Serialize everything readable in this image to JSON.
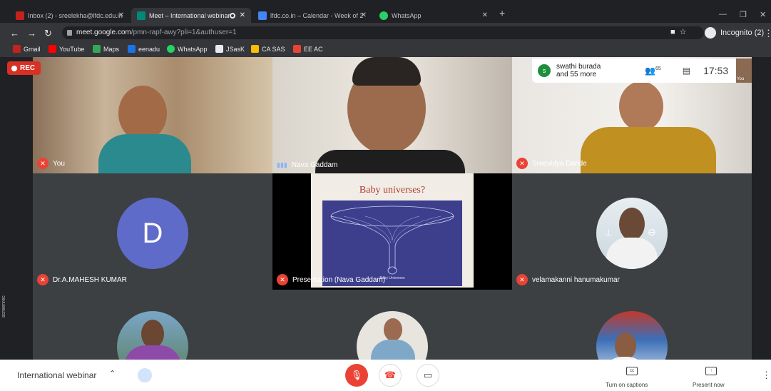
{
  "browser": {
    "tabs": [
      {
        "title": "Inbox (2) - sreelekha@lfdc.edu.in",
        "color": "#c5221f"
      },
      {
        "title": "Meet – International webinar",
        "color": "#00897b"
      },
      {
        "title": "lfdc.co.in – Calendar - Week of 2",
        "color": "#4285f4"
      },
      {
        "title": "WhatsApp",
        "color": "#25d366"
      }
    ],
    "new_tab": "+",
    "url_host": "meet.google.com",
    "url_path": "/pmn-rapf-awy?pli=1&authuser=1",
    "incognito": "Incognito (2)",
    "bookmarks": [
      {
        "label": "Gmail",
        "color": "#c5221f"
      },
      {
        "label": "YouTube",
        "color": "#ff0000"
      },
      {
        "label": "Maps",
        "color": "#34a853"
      },
      {
        "label": "eenadu",
        "color": "#1a73e8"
      },
      {
        "label": "WhatsApp",
        "color": "#25d366"
      },
      {
        "label": "JSasK",
        "color": "#e8eaed"
      },
      {
        "label": "CA SAS",
        "color": "#fbbc04"
      },
      {
        "label": "EE AC",
        "color": "#ea4335"
      }
    ]
  },
  "meet": {
    "rec_label": "REC",
    "participants_summary": "swathi burada\nand 55 more",
    "summary_avatar": "s",
    "people_count": "65",
    "clock": "17:53",
    "self_label": "You",
    "screen_rec": "screenrec",
    "tiles": [
      {
        "name": "You",
        "muted": true
      },
      {
        "name": "Nava Gaddam",
        "muted": false
      },
      {
        "name": "Sreevidya Dande",
        "muted": true
      },
      {
        "name": "Dr.A.MAHESH KUMAR",
        "muted": true,
        "initial": "D"
      },
      {
        "name": "Presentation (Nava Gaddam)",
        "muted": true,
        "slide_title": "Baby universes?",
        "slide_caption": "Baby Universes"
      },
      {
        "name": "velamakanni hanumakumar",
        "muted": true
      }
    ]
  },
  "bottombar": {
    "meeting_title": "International webinar",
    "captions_label": "Turn on captions",
    "present_label": "Present now"
  }
}
